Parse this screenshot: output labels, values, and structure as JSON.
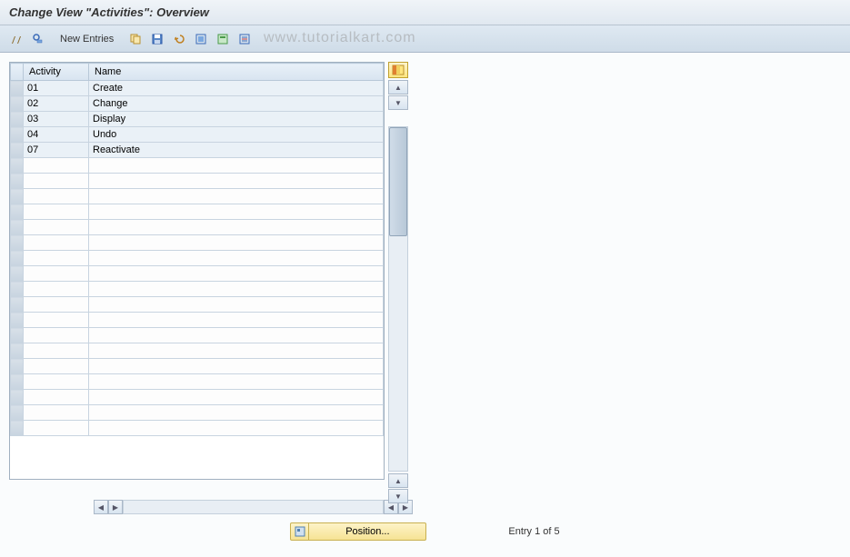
{
  "title": "Change View \"Activities\": Overview",
  "toolbar": {
    "new_entries_label": "New Entries"
  },
  "watermark": "www.tutorialkart.com",
  "table": {
    "headers": {
      "activity": "Activity",
      "name": "Name"
    },
    "rows": [
      {
        "activity": "01",
        "name": "Create"
      },
      {
        "activity": "02",
        "name": "Change"
      },
      {
        "activity": "03",
        "name": "Display"
      },
      {
        "activity": "04",
        "name": "Undo"
      },
      {
        "activity": "07",
        "name": "Reactivate"
      }
    ],
    "empty_rows": 18
  },
  "footer": {
    "position_label": "Position...",
    "entry_status": "Entry 1 of 5"
  }
}
